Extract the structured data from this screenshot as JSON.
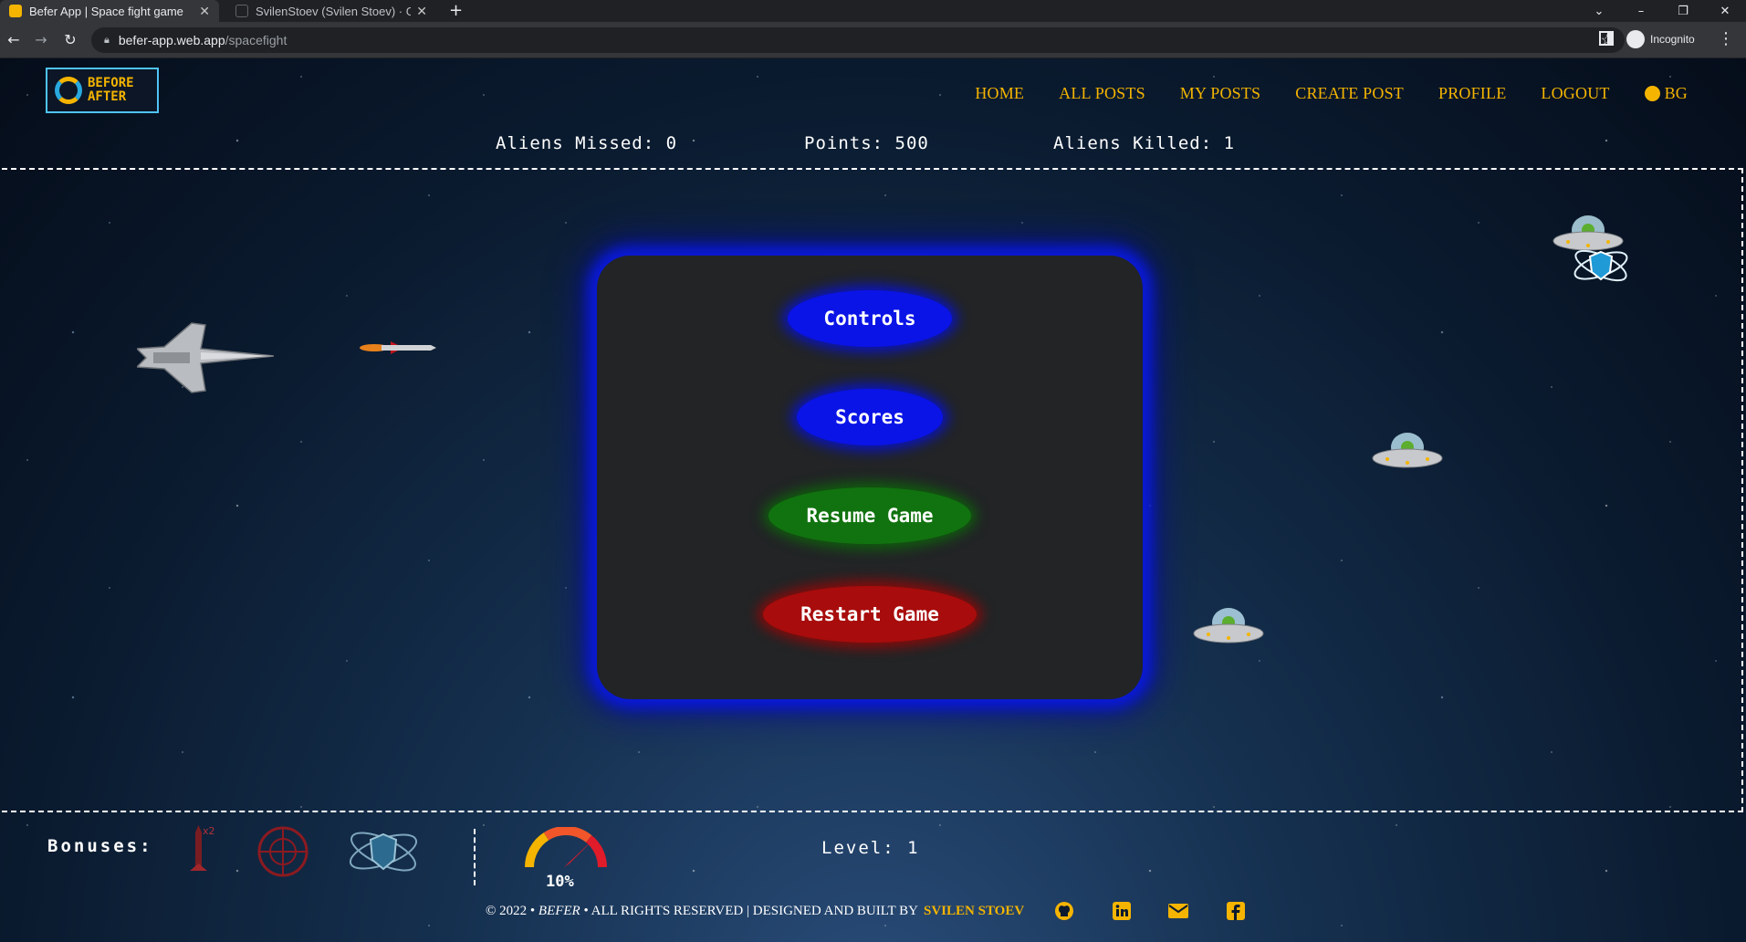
{
  "browser": {
    "tabs": [
      {
        "title": "Befer App | Space fight game",
        "favicon_color": "#f4b400",
        "active": true
      },
      {
        "title": "SvilenStoev (Svilen Stoev) · GitHu",
        "favicon_color": "#202124",
        "active": false
      }
    ],
    "new_tab_label": "+",
    "url_host": "befer-app.web.app",
    "url_path": "/spacefight",
    "profile_label": "Incognito",
    "window_controls": [
      "⌄",
      "–",
      "❐",
      "✕"
    ]
  },
  "site": {
    "logo_line1": "BEFORE",
    "logo_line2": "AFTER",
    "nav": [
      "HOME",
      "ALL POSTS",
      "MY POSTS",
      "CREATE POST",
      "PROFILE",
      "LOGOUT"
    ],
    "language": "BG",
    "accent_color": "#f4b400"
  },
  "stats": {
    "missed": "Aliens Missed: 0",
    "points": "Points: 500",
    "killed": "Aliens Killed: 1"
  },
  "game": {
    "sprites": [
      "fighter-jet",
      "missile",
      "ufo",
      "ufo",
      "ufo",
      "shield-bonus"
    ],
    "menu": {
      "controls": "Controls",
      "scores": "Scores",
      "resume": "Resume Game",
      "restart": "Restart Game"
    }
  },
  "hud": {
    "bonuses_label": "Bonuses:",
    "bonus_icons": [
      "double-missile-icon",
      "crosshair-icon",
      "shield-icon"
    ],
    "speed_value": "10%",
    "level": "Level: 1"
  },
  "footer": {
    "copyright_prefix": "© 2022 •",
    "brand": "BEFER",
    "copyright_suffix": "• ALL RIGHTS RESERVED | DESIGNED AND BUILT BY",
    "author": "SVILEN STOEV",
    "social_icons": [
      "github-icon",
      "linkedin-icon",
      "email-icon",
      "facebook-icon"
    ]
  }
}
